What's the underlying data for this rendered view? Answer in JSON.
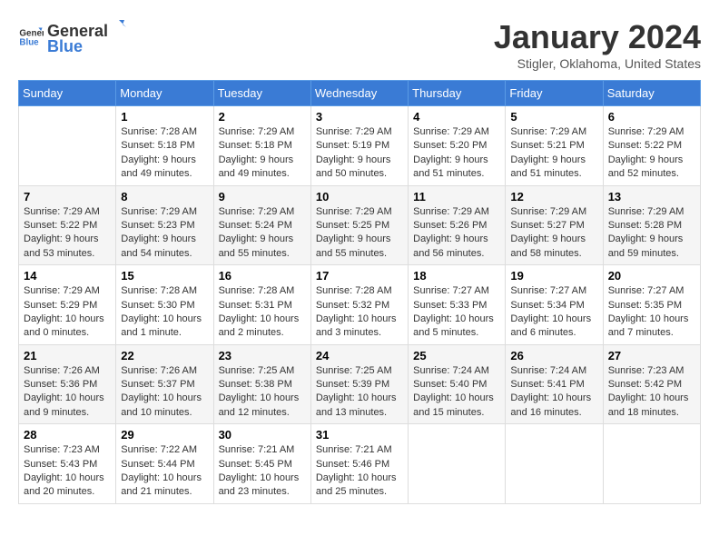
{
  "logo": {
    "text_general": "General",
    "text_blue": "Blue"
  },
  "title": {
    "month": "January 2024",
    "location": "Stigler, Oklahoma, United States"
  },
  "headers": [
    "Sunday",
    "Monday",
    "Tuesday",
    "Wednesday",
    "Thursday",
    "Friday",
    "Saturday"
  ],
  "weeks": [
    [
      {
        "day": "",
        "info": ""
      },
      {
        "day": "1",
        "info": "Sunrise: 7:28 AM\nSunset: 5:18 PM\nDaylight: 9 hours\nand 49 minutes."
      },
      {
        "day": "2",
        "info": "Sunrise: 7:29 AM\nSunset: 5:18 PM\nDaylight: 9 hours\nand 49 minutes."
      },
      {
        "day": "3",
        "info": "Sunrise: 7:29 AM\nSunset: 5:19 PM\nDaylight: 9 hours\nand 50 minutes."
      },
      {
        "day": "4",
        "info": "Sunrise: 7:29 AM\nSunset: 5:20 PM\nDaylight: 9 hours\nand 51 minutes."
      },
      {
        "day": "5",
        "info": "Sunrise: 7:29 AM\nSunset: 5:21 PM\nDaylight: 9 hours\nand 51 minutes."
      },
      {
        "day": "6",
        "info": "Sunrise: 7:29 AM\nSunset: 5:22 PM\nDaylight: 9 hours\nand 52 minutes."
      }
    ],
    [
      {
        "day": "7",
        "info": "Sunrise: 7:29 AM\nSunset: 5:22 PM\nDaylight: 9 hours\nand 53 minutes."
      },
      {
        "day": "8",
        "info": "Sunrise: 7:29 AM\nSunset: 5:23 PM\nDaylight: 9 hours\nand 54 minutes."
      },
      {
        "day": "9",
        "info": "Sunrise: 7:29 AM\nSunset: 5:24 PM\nDaylight: 9 hours\nand 55 minutes."
      },
      {
        "day": "10",
        "info": "Sunrise: 7:29 AM\nSunset: 5:25 PM\nDaylight: 9 hours\nand 55 minutes."
      },
      {
        "day": "11",
        "info": "Sunrise: 7:29 AM\nSunset: 5:26 PM\nDaylight: 9 hours\nand 56 minutes."
      },
      {
        "day": "12",
        "info": "Sunrise: 7:29 AM\nSunset: 5:27 PM\nDaylight: 9 hours\nand 58 minutes."
      },
      {
        "day": "13",
        "info": "Sunrise: 7:29 AM\nSunset: 5:28 PM\nDaylight: 9 hours\nand 59 minutes."
      }
    ],
    [
      {
        "day": "14",
        "info": "Sunrise: 7:29 AM\nSunset: 5:29 PM\nDaylight: 10 hours\nand 0 minutes."
      },
      {
        "day": "15",
        "info": "Sunrise: 7:28 AM\nSunset: 5:30 PM\nDaylight: 10 hours\nand 1 minute."
      },
      {
        "day": "16",
        "info": "Sunrise: 7:28 AM\nSunset: 5:31 PM\nDaylight: 10 hours\nand 2 minutes."
      },
      {
        "day": "17",
        "info": "Sunrise: 7:28 AM\nSunset: 5:32 PM\nDaylight: 10 hours\nand 3 minutes."
      },
      {
        "day": "18",
        "info": "Sunrise: 7:27 AM\nSunset: 5:33 PM\nDaylight: 10 hours\nand 5 minutes."
      },
      {
        "day": "19",
        "info": "Sunrise: 7:27 AM\nSunset: 5:34 PM\nDaylight: 10 hours\nand 6 minutes."
      },
      {
        "day": "20",
        "info": "Sunrise: 7:27 AM\nSunset: 5:35 PM\nDaylight: 10 hours\nand 7 minutes."
      }
    ],
    [
      {
        "day": "21",
        "info": "Sunrise: 7:26 AM\nSunset: 5:36 PM\nDaylight: 10 hours\nand 9 minutes."
      },
      {
        "day": "22",
        "info": "Sunrise: 7:26 AM\nSunset: 5:37 PM\nDaylight: 10 hours\nand 10 minutes."
      },
      {
        "day": "23",
        "info": "Sunrise: 7:25 AM\nSunset: 5:38 PM\nDaylight: 10 hours\nand 12 minutes."
      },
      {
        "day": "24",
        "info": "Sunrise: 7:25 AM\nSunset: 5:39 PM\nDaylight: 10 hours\nand 13 minutes."
      },
      {
        "day": "25",
        "info": "Sunrise: 7:24 AM\nSunset: 5:40 PM\nDaylight: 10 hours\nand 15 minutes."
      },
      {
        "day": "26",
        "info": "Sunrise: 7:24 AM\nSunset: 5:41 PM\nDaylight: 10 hours\nand 16 minutes."
      },
      {
        "day": "27",
        "info": "Sunrise: 7:23 AM\nSunset: 5:42 PM\nDaylight: 10 hours\nand 18 minutes."
      }
    ],
    [
      {
        "day": "28",
        "info": "Sunrise: 7:23 AM\nSunset: 5:43 PM\nDaylight: 10 hours\nand 20 minutes."
      },
      {
        "day": "29",
        "info": "Sunrise: 7:22 AM\nSunset: 5:44 PM\nDaylight: 10 hours\nand 21 minutes."
      },
      {
        "day": "30",
        "info": "Sunrise: 7:21 AM\nSunset: 5:45 PM\nDaylight: 10 hours\nand 23 minutes."
      },
      {
        "day": "31",
        "info": "Sunrise: 7:21 AM\nSunset: 5:46 PM\nDaylight: 10 hours\nand 25 minutes."
      },
      {
        "day": "",
        "info": ""
      },
      {
        "day": "",
        "info": ""
      },
      {
        "day": "",
        "info": ""
      }
    ]
  ]
}
